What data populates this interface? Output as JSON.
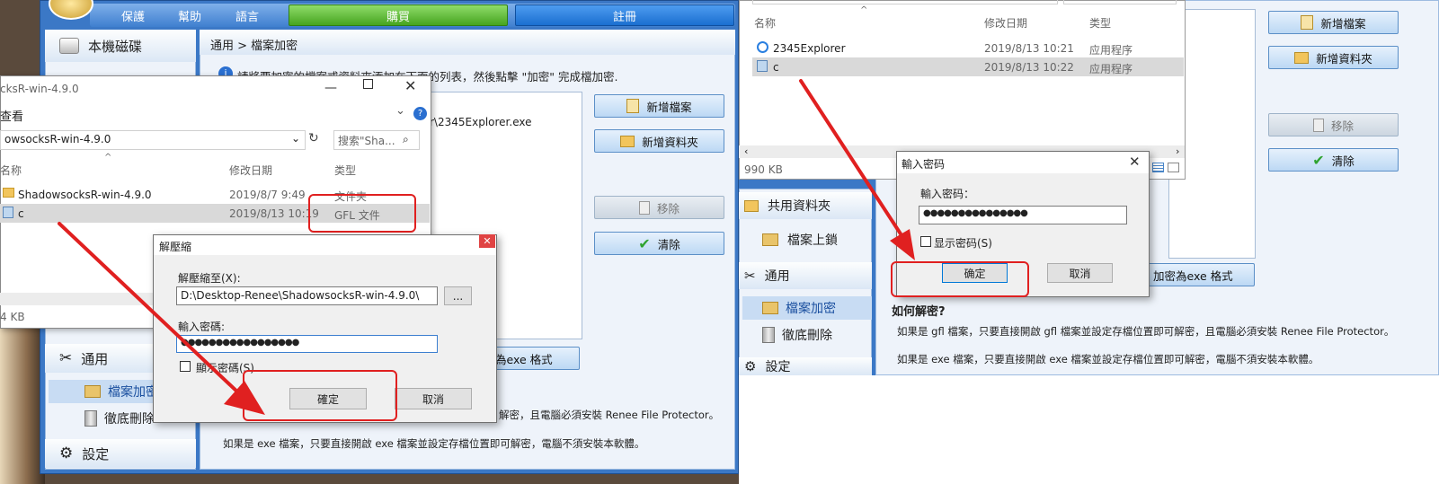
{
  "left_app": {
    "menu": {
      "protect": "保護",
      "help": "幫助",
      "language": "語言"
    },
    "buy_label": "購買",
    "register_label": "註冊",
    "sidebar": {
      "local_disk": "本機磁碟",
      "general": "通用",
      "encrypt": "檔案加密",
      "shred": "徹底刪除",
      "settings": "設定"
    },
    "breadcrumb": "通用 > 檔案加密",
    "info_text": "請將要加密的檔案或資料夾添加在下面的列表，然後點擊 \"加密\" 完成檔加密.",
    "file_path_partial": "r\\2345Explorer.exe",
    "add_file": "新增檔案",
    "add_folder": "新增資料夾",
    "remove": "移除",
    "clear": "清除",
    "exe_partial": "為exe 格式",
    "note1_partial": "解密，且電腦必須安裝 Renee File Protector。",
    "note2": "如果是 exe 檔案，只要直接開啟 exe 檔案並設定存檔位置即可解密，電腦不須安裝本軟體。"
  },
  "explorer_left": {
    "title": "cksR-win-4.9.0",
    "view": "查看",
    "address": "owsocksR-win-4.9.0",
    "search_placeholder": "搜索\"Sha...",
    "col_name": "名称",
    "col_date": "修改日期",
    "col_type": "类型",
    "rows": [
      {
        "name": "ShadowsocksR-win-4.9.0",
        "date": "2019/8/7 9:49",
        "type": "文件夹"
      },
      {
        "name": "c",
        "date": "2019/8/13 10:19",
        "type": "GFL 文件"
      }
    ],
    "status": "4 KB"
  },
  "extract_dialog": {
    "title": "解壓縮",
    "extract_to_label": "解壓縮至(X):",
    "path": "D:\\Desktop-Renee\\ShadowsocksR-win-4.9.0\\",
    "browse": "...",
    "password_label": "輸入密碼:",
    "password_value": "●●●●●●●●●●●●●●●●●",
    "show_password": "顯示密碼(S)",
    "ok": "確定",
    "cancel": "取消"
  },
  "explorer_right": {
    "col_name": "名称",
    "col_date": "修改日期",
    "col_type": "类型",
    "rows": [
      {
        "name": "2345Explorer",
        "date": "2019/8/13 10:21",
        "type": "应用程序"
      },
      {
        "name": "c",
        "date": "2019/8/13 10:22",
        "type": "应用程序"
      }
    ],
    "status": "990 KB"
  },
  "right_app": {
    "add_file": "新增檔案",
    "add_folder": "新增資料夾",
    "remove": "移除",
    "clear": "清除",
    "sidebar": {
      "shared": "共用資料夾",
      "file_lock": "檔案上鎖",
      "general": "通用",
      "encrypt": "檔案加密",
      "shred": "徹底刪除",
      "settings": "設定"
    },
    "exe_button": "加密為exe 格式",
    "how_title": "如何解密?",
    "note1": "如果是 gfl 檔案，只要直接開啟 gfl 檔案並設定存檔位置即可解密，且電腦必須安裝 Renee File Protector。",
    "note2": "如果是 exe 檔案，只要直接開啟 exe 檔案並設定存檔位置即可解密，電腦不須安裝本軟體。"
  },
  "password_dialog": {
    "title": "輸入密码",
    "label": "輸入密码：",
    "value": "●●●●●●●●●●●●●●●",
    "show_password": "显示密码(S)",
    "ok": "确定",
    "cancel": "取消"
  },
  "colors": {
    "accent_red": "#e02020",
    "buy_green": "#52b52a",
    "register_blue": "#1a6fd0",
    "frame_blue": "#3b78c6"
  }
}
